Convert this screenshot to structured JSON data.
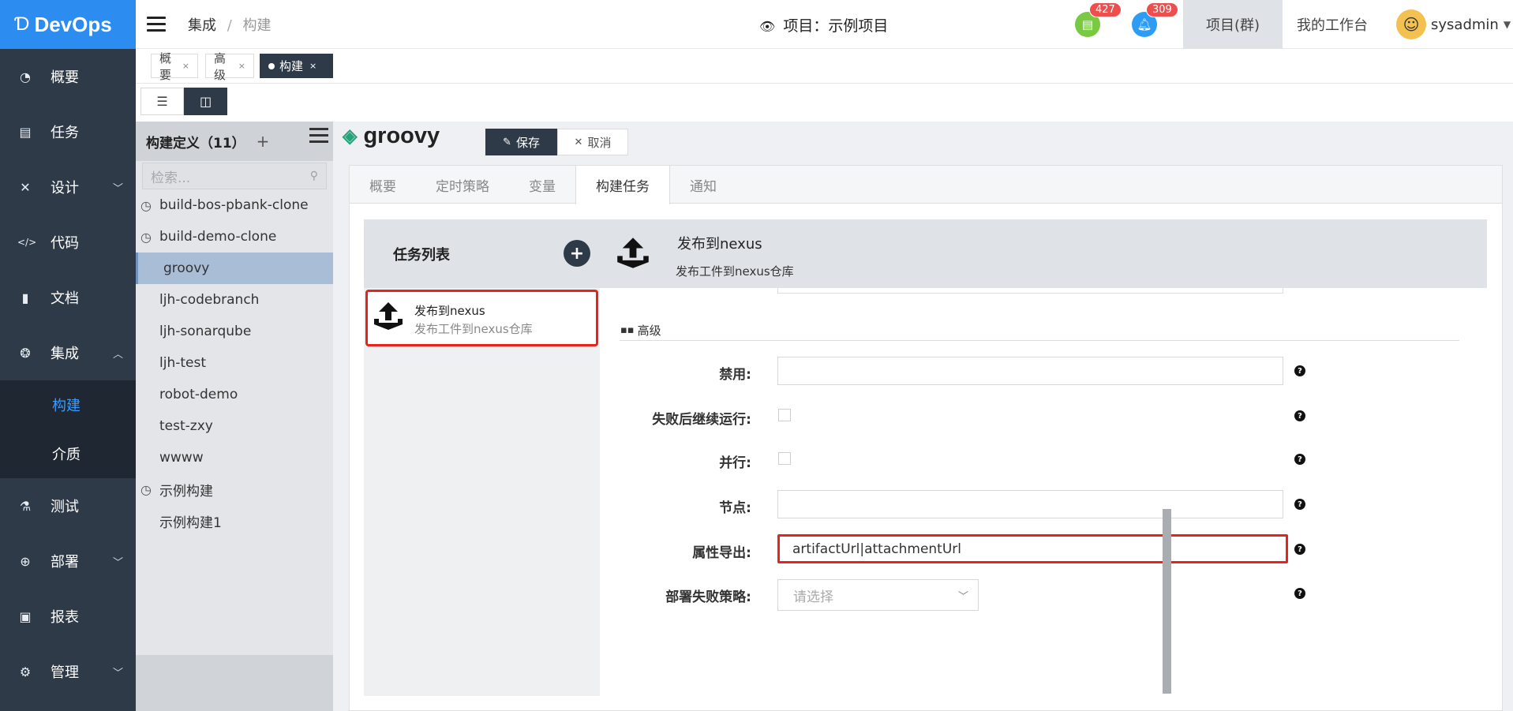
{
  "app": {
    "logo_text": "DevOps",
    "logo_mark": "Ɗ"
  },
  "sidebar": {
    "items": [
      {
        "label": "概要",
        "icon": "dashboard-icon"
      },
      {
        "label": "任务",
        "icon": "tasks-icon"
      },
      {
        "label": "设计",
        "icon": "design-icon"
      },
      {
        "label": "代码",
        "icon": "code-icon"
      },
      {
        "label": "文档",
        "icon": "document-icon"
      },
      {
        "label": "集成",
        "icon": "integration-icon"
      },
      {
        "label": "测试",
        "icon": "test-flask-icon"
      },
      {
        "label": "部署",
        "icon": "deploy-icon"
      },
      {
        "label": "报表",
        "icon": "report-icon"
      },
      {
        "label": "管理",
        "icon": "gear-icon"
      }
    ],
    "sub_items": [
      {
        "label": "构建"
      },
      {
        "label": "介质"
      }
    ]
  },
  "header": {
    "breadcrumb": [
      "集成",
      "/",
      "构建"
    ],
    "project_label": "项目：示例项目",
    "badge_doc": "427",
    "badge_bell": "309",
    "tab_projects": "项目(群)",
    "tab_workbench": "我的工作台",
    "username": "sysadmin"
  },
  "page_tabs": [
    {
      "label": "概要",
      "close": "×"
    },
    {
      "label": "高级",
      "close": "×"
    },
    {
      "label": "构建",
      "close": "×"
    }
  ],
  "build_panel": {
    "title": "构建定义（11）",
    "add": "+",
    "search_placeholder": "检索...",
    "items": [
      {
        "label": "build-bos-pbank-clone"
      },
      {
        "label": "build-demo-clone"
      },
      {
        "label": "groovy"
      },
      {
        "label": "ljh-codebranch"
      },
      {
        "label": "ljh-sonarqube"
      },
      {
        "label": "ljh-test"
      },
      {
        "label": "robot-demo"
      },
      {
        "label": "test-zxy"
      },
      {
        "label": "wwww"
      },
      {
        "label": "示例构建"
      },
      {
        "label": "示例构建1"
      }
    ]
  },
  "main": {
    "title": "groovy",
    "save_label": "保存",
    "cancel_label": "取消",
    "tabs": [
      "概要",
      "定时策略",
      "变量",
      "构建任务",
      "通知"
    ],
    "task_list_title": "任务列表",
    "task_add": "+",
    "task": {
      "name": "发布到nexus",
      "desc": "发布工件到nexus仓库"
    },
    "detail": {
      "name": "发布到nexus",
      "desc": "发布工件到nexus仓库"
    },
    "section_title": "高级",
    "fields": {
      "disable_label": "禁用:",
      "continue_label": "失败后继续运行:",
      "parallel_label": "并行:",
      "node_label": "节点:",
      "export_label": "属性导出:",
      "export_value": "artifactUrl|attachmentUrl",
      "deploy_fail_label": "部署失败策略:",
      "deploy_fail_placeholder": "请选择"
    },
    "help_glyph": "?"
  }
}
